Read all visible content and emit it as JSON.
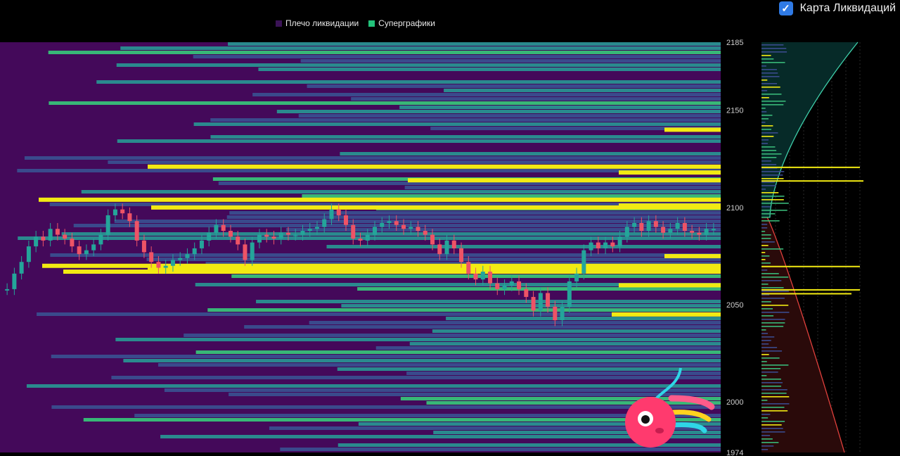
{
  "legend": {
    "items": [
      {
        "label": "Плечо ликвидации",
        "color": "#3a1356"
      },
      {
        "label": "Суперграфики",
        "color": "#22c27a"
      }
    ]
  },
  "toggle": {
    "label": "Карта Ликвидаций",
    "checked": true
  },
  "chart_data": {
    "type": "heatmap",
    "title": "",
    "ylim": [
      1974,
      2185
    ],
    "yticks": [
      "2185",
      "2150",
      "2100",
      "2050",
      "2000",
      "1974"
    ],
    "colors": {
      "background": "#44095a",
      "low": "#3a4a8c",
      "mid": "#2a8a8e",
      "high": "#38b777",
      "max": "#f2ea12",
      "up_candle": "#24a59a",
      "down_candle": "#ee5366",
      "panel_short_fill": "#062a28",
      "panel_long_fill": "#2a0a0a",
      "panel_short_line": "#3ecfaa",
      "panel_long_line": "#e0403c"
    },
    "price_series": [
      2058,
      2066,
      2072,
      2080,
      2085,
      2083,
      2089,
      2086,
      2084,
      2080,
      2076,
      2078,
      2081,
      2086,
      2096,
      2099,
      2097,
      2093,
      2083,
      2077,
      2072,
      2069,
      2070,
      2073,
      2074,
      2076,
      2079,
      2083,
      2087,
      2091,
      2088,
      2085,
      2081,
      2073,
      2082,
      2086,
      2085,
      2084,
      2087,
      2086,
      2086,
      2088,
      2089,
      2090,
      2094,
      2099,
      2096,
      2091,
      2084,
      2083,
      2086,
      2090,
      2092,
      2093,
      2091,
      2089,
      2090,
      2088,
      2086,
      2081,
      2076,
      2083,
      2079,
      2072,
      2066,
      2063,
      2067,
      2061,
      2058,
      2060,
      2062,
      2058,
      2054,
      2047,
      2056,
      2049,
      2042,
      2049,
      2062,
      2066,
      2078,
      2082,
      2079,
      2082,
      2080,
      2085,
      2090,
      2092,
      2088,
      2093,
      2090,
      2087,
      2089,
      2092,
      2088,
      2087,
      2086,
      2089,
      2089
    ]
  }
}
